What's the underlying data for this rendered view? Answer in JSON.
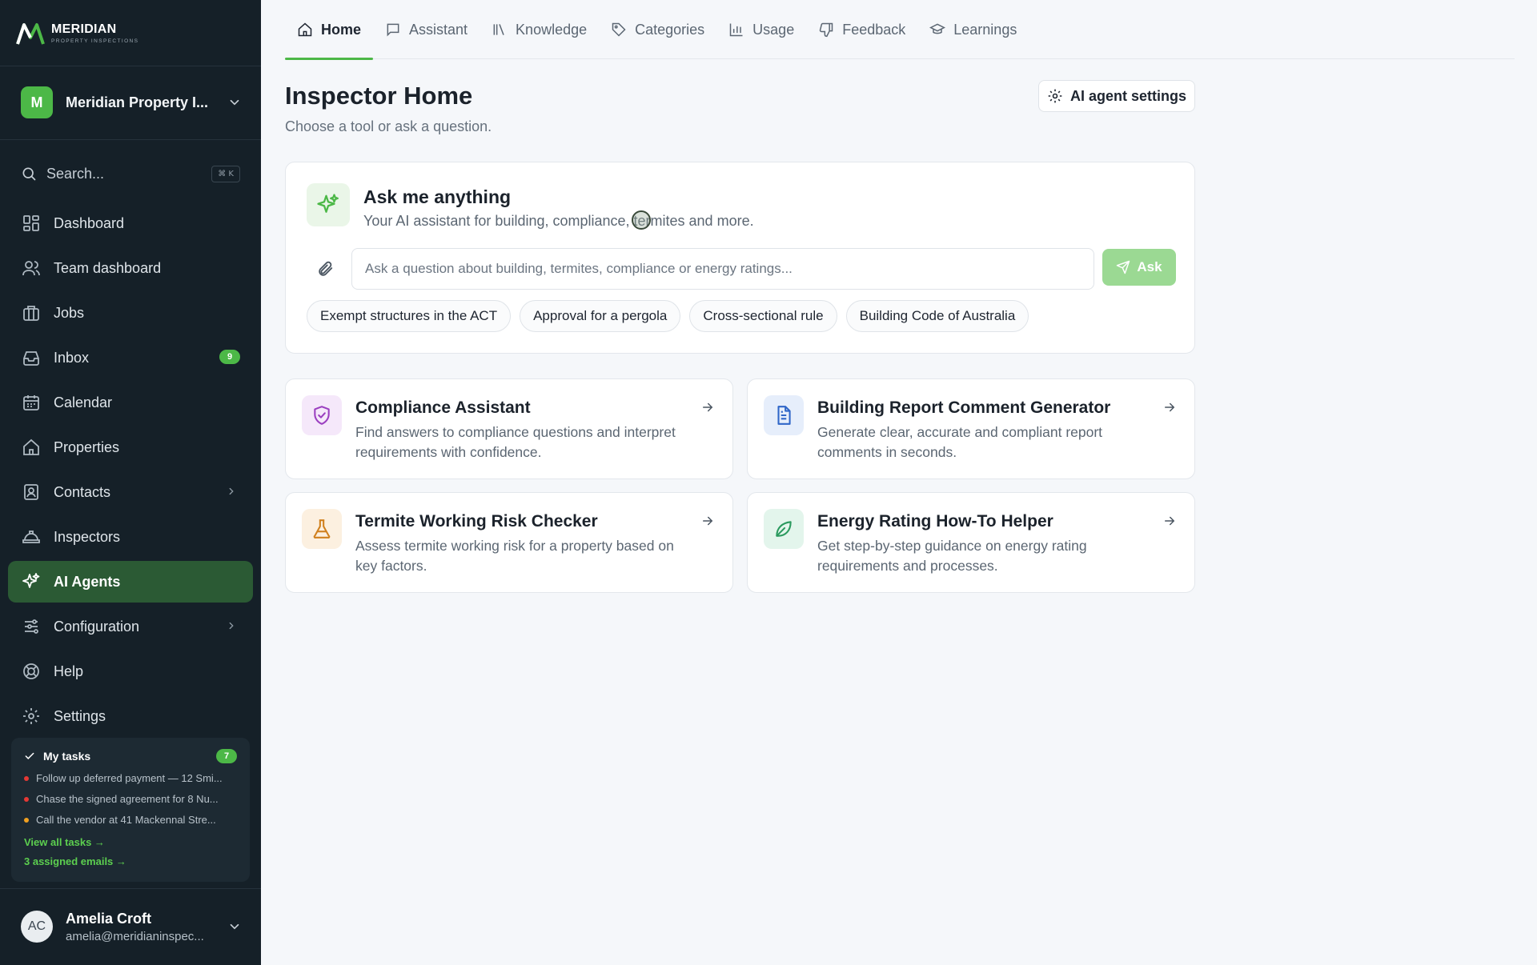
{
  "brand": {
    "name": "MERIDIAN",
    "tagline": "PROPERTY INSPECTIONS"
  },
  "org": {
    "initial": "M",
    "name": "Meridian Property I..."
  },
  "search": {
    "placeholder": "Search...",
    "shortcut": "⌘ K"
  },
  "nav": [
    {
      "label": "Dashboard",
      "icon": "grid-icon"
    },
    {
      "label": "Team dashboard",
      "icon": "users-icon"
    },
    {
      "label": "Jobs",
      "icon": "briefcase-icon"
    },
    {
      "label": "Inbox",
      "icon": "inbox-icon",
      "badge": "9"
    },
    {
      "label": "Calendar",
      "icon": "calendar-icon"
    },
    {
      "label": "Properties",
      "icon": "home-icon"
    },
    {
      "label": "Contacts",
      "icon": "contact-icon",
      "has_submenu": true
    },
    {
      "label": "Inspectors",
      "icon": "hardhat-icon"
    },
    {
      "label": "AI Agents",
      "icon": "sparkles-icon",
      "active": true
    },
    {
      "label": "Configuration",
      "icon": "sliders-icon",
      "has_submenu": true
    },
    {
      "label": "Help",
      "icon": "lifebuoy-icon"
    },
    {
      "label": "Settings",
      "icon": "gear-icon"
    }
  ],
  "tasks": {
    "title": "My tasks",
    "count": "7",
    "items": [
      {
        "text": "Follow up deferred payment — 12 Smi...",
        "color": "#e53935"
      },
      {
        "text": "Chase the signed agreement for 8 Nu...",
        "color": "#e53935"
      },
      {
        "text": "Call the vendor at 41 Mackennal Stre...",
        "color": "#f0a020"
      }
    ],
    "view_all": "View all tasks →",
    "emails": "3 assigned emails →"
  },
  "user": {
    "initials": "AC",
    "name": "Amelia Croft",
    "email": "amelia@meridianinspec..."
  },
  "tabs": [
    {
      "label": "Home",
      "icon": "home-icon",
      "active": true
    },
    {
      "label": "Assistant",
      "icon": "chat-icon"
    },
    {
      "label": "Knowledge",
      "icon": "library-icon"
    },
    {
      "label": "Categories",
      "icon": "tag-icon"
    },
    {
      "label": "Usage",
      "icon": "bar-chart-icon"
    },
    {
      "label": "Feedback",
      "icon": "thumbs-down-icon"
    },
    {
      "label": "Learnings",
      "icon": "graduation-cap-icon"
    }
  ],
  "page": {
    "title": "Inspector Home",
    "subtitle": "Choose a tool or ask a question.",
    "settings_label": "AI agent settings"
  },
  "ask": {
    "title": "Ask me anything",
    "subtitle": "Your AI assistant for building, compliance, termites and more.",
    "placeholder": "Ask a question about building, termites, compliance or energy ratings...",
    "button": "Ask",
    "chips": [
      "Exempt structures in the ACT",
      "Approval for a pergola",
      "Cross-sectional rule",
      "Building Code of Australia"
    ]
  },
  "tools": [
    {
      "title": "Compliance Assistant",
      "desc": "Find answers to compliance questions and interpret requirements with confidence.",
      "icon": "shield-check-icon",
      "bg": "#f5e8fa",
      "fg": "#9b3fc0"
    },
    {
      "title": "Building Report Comment Generator",
      "desc": "Generate clear, accurate and compliant report comments in seconds.",
      "icon": "document-icon",
      "bg": "#e6eefb",
      "fg": "#2f66c8"
    },
    {
      "title": "Termite Working Risk Checker",
      "desc": "Assess termite working risk for a property based on key factors.",
      "icon": "flask-icon",
      "bg": "#fcf0e0",
      "fg": "#d0801e"
    },
    {
      "title": "Energy Rating How-To Helper",
      "desc": "Get step-by-step guidance on energy rating requirements and processes.",
      "icon": "leaf-icon",
      "bg": "#e3f5ec",
      "fg": "#2a9a5e"
    }
  ],
  "colors": {
    "accent": "#4cb847",
    "sidebar": "#152028",
    "active_nav": "#2b5a34"
  }
}
